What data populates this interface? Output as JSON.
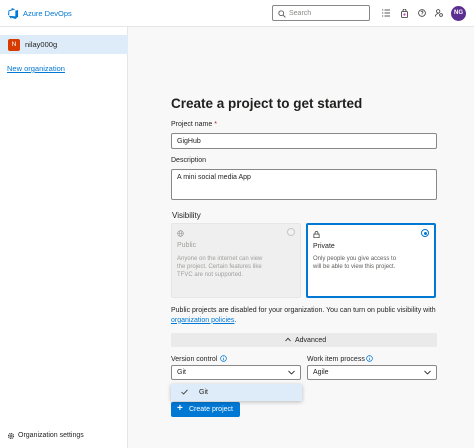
{
  "header": {
    "brand": "Azure DevOps",
    "search_placeholder": "Search",
    "avatar_initials": "NG"
  },
  "sidebar": {
    "org": {
      "initial": "N",
      "name": "nilay000g"
    },
    "new_org_link": "New organization",
    "settings_label": "Organization settings"
  },
  "main": {
    "title": "Create a project to get started",
    "project_name_label": "Project name",
    "required_mark": "*",
    "project_name_value": "GigHub",
    "description_label": "Description",
    "description_value": "A mini social media App",
    "visibility_label": "Visibility",
    "visibility_options": [
      {
        "title": "Public",
        "description": "Anyone on the internet can view the project. Certain features like TFVC are not supported.",
        "selected": false,
        "disabled": true
      },
      {
        "title": "Private",
        "description": "Only people you give access to will be able to view this project.",
        "selected": true,
        "disabled": false
      }
    ],
    "note_text": "Public projects are disabled for your organization. You can turn on public visibility with",
    "note_link": "organization policies",
    "note_end": ".",
    "advanced_label": "Advanced",
    "version_control_label": "Version control",
    "version_control_value": "Git",
    "work_item_label": "Work item process",
    "work_item_value": "Agile",
    "dropdown_options": [
      "Git"
    ],
    "create_button": "Create project"
  },
  "colors": {
    "accent": "#0078d4",
    "avatar": "#5c2e91",
    "org_badge": "#d83b01",
    "selected_bg": "#deecf9"
  }
}
